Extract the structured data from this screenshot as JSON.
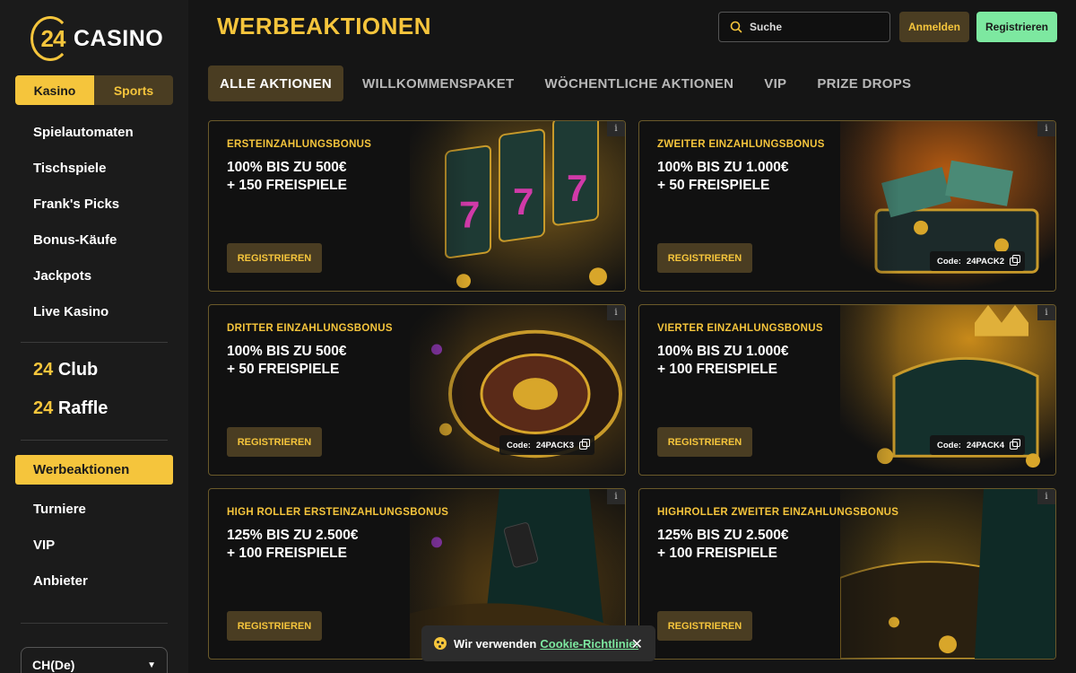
{
  "logo": {
    "number": "24",
    "text": "CASINO"
  },
  "toggle": {
    "kasino": "Kasino",
    "sports": "Sports"
  },
  "nav": [
    "Spielautomaten",
    "Tischspiele",
    "Frank's Picks",
    "Bonus-Käufe",
    "Jackpots",
    "Live Kasino"
  ],
  "clubs": [
    {
      "num": "24",
      "name": "Club"
    },
    {
      "num": "24",
      "name": "Raffle"
    }
  ],
  "nav2": [
    "Werbeaktionen",
    "Turniere",
    "VIP",
    "Anbieter"
  ],
  "language": "CH(De)",
  "page_title": "WERBEAKTIONEN",
  "search": {
    "placeholder": "Suche"
  },
  "header": {
    "login": "Anmelden",
    "register": "Registrieren"
  },
  "tabs": [
    "ALLE AKTIONEN",
    "WILLKOMMENSPAKET",
    "WÖCHENTLICHE AKTIONEN",
    "VIP",
    "PRIZE DROPS"
  ],
  "cards": [
    {
      "label": "ERSTEINZAHLUNGSBONUS",
      "line1": "100% BIS ZU 500€",
      "line2": "+ 150 FREISPIELE",
      "button": "REGISTRIEREN",
      "code_label": "",
      "code": ""
    },
    {
      "label": "ZWEITER EINZAHLUNGSBONUS",
      "line1": "100% BIS ZU 1.000€",
      "line2": "+ 50 FREISPIELE",
      "button": "REGISTRIEREN",
      "code_label": "Code:",
      "code": "24PACK2"
    },
    {
      "label": "DRITTER EINZAHLUNGSBONUS",
      "line1": "100% BIS ZU 500€",
      "line2": "+ 50 FREISPIELE",
      "button": "REGISTRIEREN",
      "code_label": "Code:",
      "code": "24PACK3"
    },
    {
      "label": "VIERTER EINZAHLUNGSBONUS",
      "line1": "100% BIS ZU 1.000€",
      "line2": "+ 100 FREISPIELE",
      "button": "REGISTRIEREN",
      "code_label": "Code:",
      "code": "24PACK4"
    },
    {
      "label": "HIGH ROLLER ERSTEINZAHLUNGSBONUS",
      "line1": "125% BIS ZU 2.500€",
      "line2": "+ 100 FREISPIELE",
      "button": "REGISTRIEREN",
      "code_label": "",
      "code": ""
    },
    {
      "label": "HIGHROLLER ZWEITER EINZAHLUNGSBONUS",
      "line1": "125% BIS ZU 2.500€",
      "line2": "+ 100 FREISPIELE",
      "button": "REGISTRIEREN",
      "code_label": "",
      "code": ""
    }
  ],
  "info_glyph": "i",
  "cookie": {
    "text": "Wir verwenden",
    "link": "Cookie-Richtlinie.",
    "close": "✕"
  },
  "colors": {
    "accent": "#f5c53c",
    "brown": "#4a3d22",
    "green": "#7de8a0",
    "background": "#151515",
    "sidebar": "#1b1b1b"
  }
}
